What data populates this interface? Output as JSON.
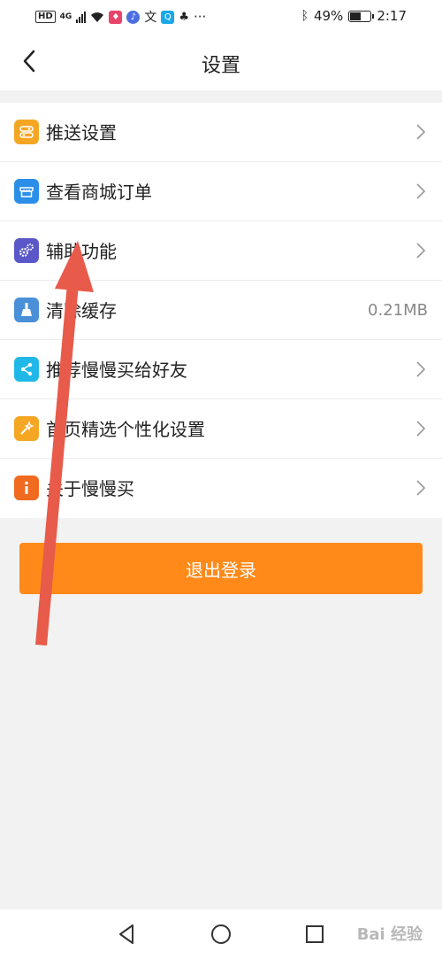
{
  "status_bar": {
    "left_indicators": [
      "HD",
      "4G"
    ],
    "overflow": "···",
    "battery_percent": "49%",
    "battery_level": 0.49,
    "time": "2:17"
  },
  "header": {
    "back_icon": "chevron-left-icon",
    "title": "设置"
  },
  "menu": {
    "items": [
      {
        "label": "推送设置",
        "icon": "push-toggle-icon",
        "icon_color": "#f5a623",
        "value": ""
      },
      {
        "label": "查看商城订单",
        "icon": "store-icon",
        "icon_color": "#2b8fe8",
        "value": ""
      },
      {
        "label": "辅助功能",
        "icon": "gears-icon",
        "icon_color": "#5a58c8",
        "value": ""
      },
      {
        "label": "清除缓存",
        "icon": "broom-icon",
        "icon_color": "#4a90d9",
        "value": "0.21MB"
      },
      {
        "label": "推荐慢慢买给好友",
        "icon": "share-icon",
        "icon_color": "#20b8e8",
        "value": ""
      },
      {
        "label": "首页精选个性化设置",
        "icon": "magic-wand-icon",
        "icon_color": "#f5a623",
        "value": ""
      },
      {
        "label": "关于慢慢买",
        "icon": "info-icon",
        "icon_color": "#f06a1f",
        "value": ""
      }
    ]
  },
  "logout": {
    "label": "退出登录",
    "color": "#ff8a1a"
  },
  "annotation": {
    "arrow_color": "#e85a4a"
  },
  "system_nav": {
    "buttons": [
      "back-triangle-icon",
      "home-circle-icon",
      "recents-square-icon"
    ]
  },
  "watermark": {
    "text": "Bai 经验"
  }
}
